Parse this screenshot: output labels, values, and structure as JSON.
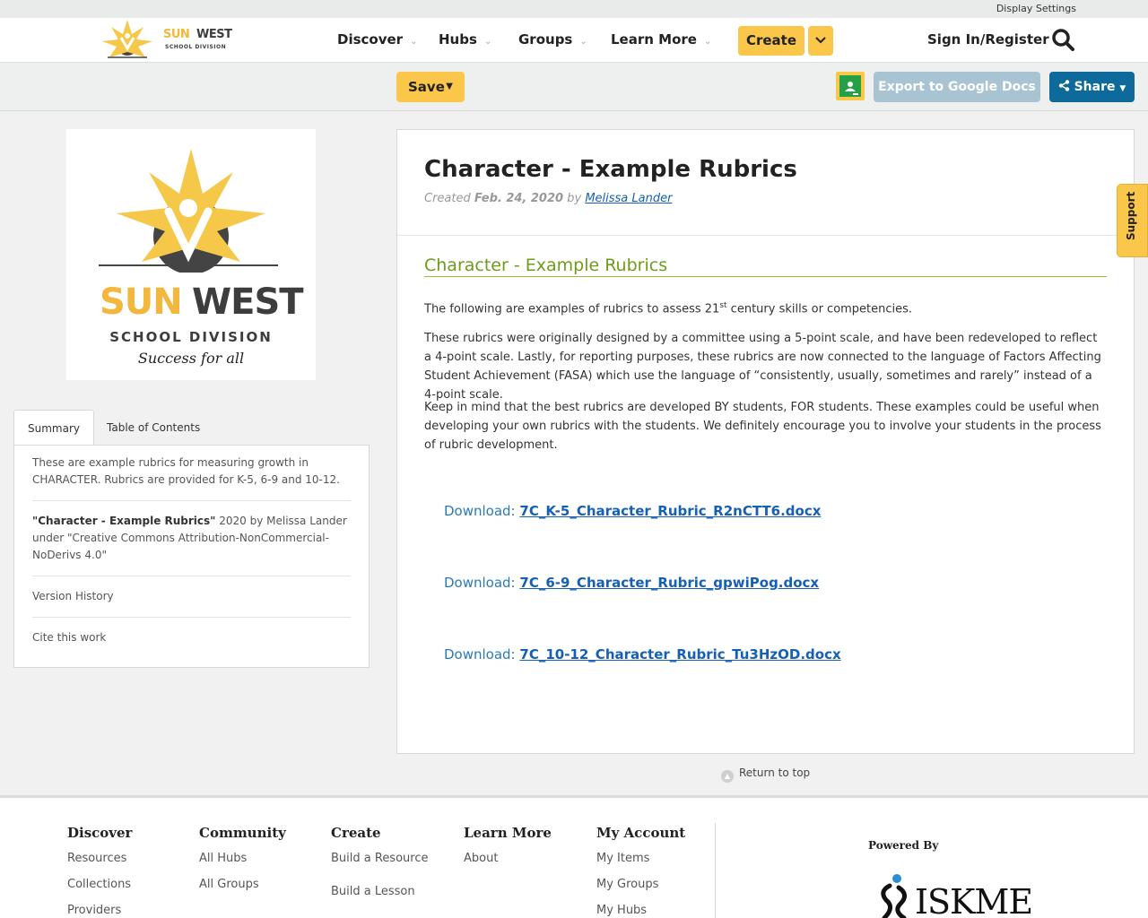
{
  "topbar": {
    "display_settings": "Display Settings"
  },
  "logo": {
    "word1": "SUN",
    "word2": "WEST",
    "subtitle": "SCHOOL DIVISION"
  },
  "nav": {
    "items": [
      "Discover",
      "Hubs",
      "Groups",
      "Learn More"
    ],
    "create": "Create",
    "signin": "Sign In/Register"
  },
  "toolbar": {
    "save": "Save",
    "export": "Export to Google Docs",
    "share": "Share"
  },
  "bigcard": {
    "word1": "SUN",
    "word2": "WEST",
    "subtitle": "SCHOOL DIVISION",
    "tagline": "Success for all"
  },
  "sidebar": {
    "tabs": [
      "Summary",
      "Table of Contents"
    ],
    "summary": "These are example rubrics for measuring growth in CHARACTER. Rubrics are provided for K-5, 6-9 and 10-12.",
    "license_title": "\"Character - Example Rubrics\"",
    "license_rest": " 2020 by Melissa Lander under \"Creative Commons Attribution-NonCommercial-NoDerivs 4.0\"",
    "version_history": "Version History",
    "cite": "Cite this work"
  },
  "main": {
    "title": "Character - Example Rubrics",
    "created_label": "Created",
    "created_date": "Feb. 24, 2020",
    "by": "by",
    "author": "Melissa Lander",
    "section_title": "Character - Example Rubrics",
    "para1_a": "The following are examples of rubrics to assess 21",
    "para1_sup": "st",
    "para1_b": " century skills or competencies.",
    "para2": "These rubrics were originally designed by a committee using a 5-point scale, and have been redeveloped to reflect a 4-point scale.  Lastly, for reporting purposes, these rubrics are now connected to the language of Factors Affecting Student Achievement (FASA) which use the language of “consistently, usually, sometimes and rarely” instead of a 4-point scale.",
    "para3": "Keep in mind that the best rubrics are developed BY students, FOR students.  These examples could be useful when developing your own rubrics with the students.  We definitely encourage you to involve your students in the process of rubric development.",
    "download_label": "Download: ",
    "downloads": [
      "7C_K-5_Character_Rubric_R2nCTT6.docx",
      "7C_6-9_Character_Rubric_gpwiPog.docx",
      "7C_10-12_Character_Rubric_Tu3HzOD.docx"
    ]
  },
  "return_top": "Return to top",
  "support": "Support",
  "footer": {
    "discover": {
      "title": "Discover",
      "items": [
        "Resources",
        "Collections",
        "Providers"
      ]
    },
    "community": {
      "title": "Community",
      "items": [
        "All Hubs",
        "All Groups"
      ]
    },
    "create": {
      "title": "Create",
      "items": [
        "Build a Resource",
        "Build a Lesson"
      ]
    },
    "learn": {
      "title": "Learn More",
      "items": [
        "About"
      ]
    },
    "account": {
      "title": "My Account",
      "items": [
        "My Items",
        "My Groups",
        "My Hubs"
      ]
    },
    "powered_by": "Powered By",
    "iskme": "ISKME"
  },
  "colors": {
    "brand_yellow": "#fbc74a",
    "share_blue": "#0e6a9a",
    "section_green": "#6d9b1c",
    "link_blue": "#1560b5"
  }
}
